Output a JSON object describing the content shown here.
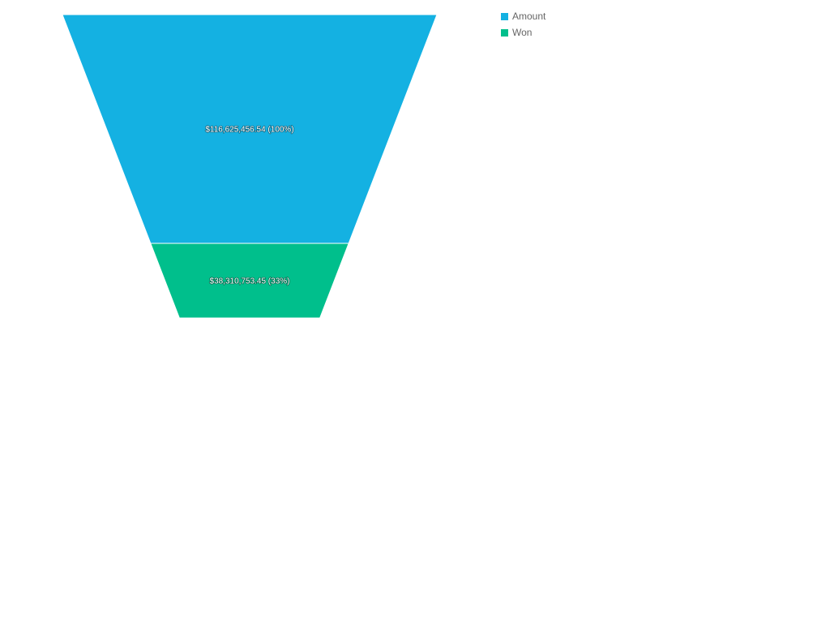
{
  "chart_data": {
    "type": "funnel",
    "categories": [
      "Amount",
      "Won"
    ],
    "values": [
      116625456.54,
      38310753.45
    ],
    "value_labels": [
      "$116,625,456.54 (100%)",
      "$38,310,753.45 (33%)"
    ],
    "percentages": [
      100,
      33
    ],
    "colors": [
      "#14b1e2",
      "#00bf8c"
    ],
    "title": "",
    "legend_position": "top-right"
  },
  "legend": {
    "items": [
      {
        "label": "Amount",
        "color": "#14b1e2"
      },
      {
        "label": "Won",
        "color": "#00bf8c"
      }
    ]
  }
}
